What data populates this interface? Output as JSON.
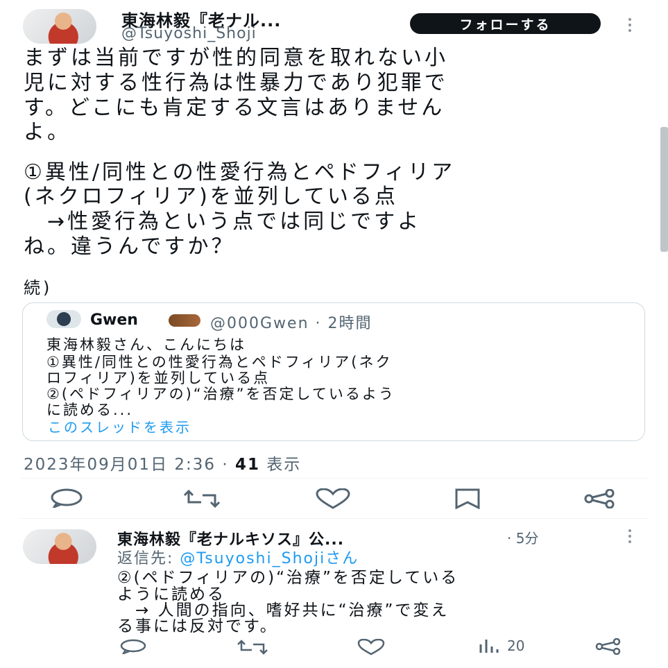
{
  "main_tweet": {
    "author_name": "東海林毅『老ナル...",
    "author_handle": "@Tsuyoshi_Shoji",
    "follow_label": "フォローする",
    "body_lines": [
      "まずは当前ですが性的同意を取れない小",
      "児に対する性行為は性暴力であり犯罪で",
      "す。どこにも肯定する文言はありません",
      "よ。",
      "①異性/同性との性愛行為とペドフィリア",
      "(ネクロフィリア)を並列している点",
      "　→性愛行為という点では同じですよ",
      "ね。違うんですか？",
      "続)"
    ],
    "quote": {
      "author_name": "Gwen",
      "meta": "@000Gwen · 2時間",
      "lines": [
        "東海林毅さん、こんにちは",
        "①異性/同性との性愛行為とペドフィリア(ネク",
        "ロフィリア)を並列している点",
        "②(ペドフィリアの)“治療”を否定しているよう",
        "に読める..."
      ],
      "show_thread": "このスレッドを表示"
    },
    "timestamp": "2023年09月01日 2:36",
    "views_count": "41",
    "views_label": "表示"
  },
  "reply_tweet": {
    "author_name": "東海林毅『老ナルキソス』公...",
    "time": "· 5分",
    "reply_prefix": "返信先: ",
    "reply_to": "@Tsuyoshi_Shojiさん",
    "body_lines": [
      "②(ペドフィリアの)“治療”を否定している",
      "ように読める",
      "　→ 人間の指向、嗜好共に“治療”で変え",
      "る事には反対です。"
    ],
    "view_count": "20"
  },
  "icons": {
    "reply": "comment-icon",
    "retweet": "retweet-icon",
    "like": "heart-icon",
    "bookmark": "bookmark-icon",
    "share": "share-icon",
    "views": "bar-chart-icon",
    "more": "more-vertical-icon"
  },
  "colors": {
    "text": "#0f1419",
    "secondary": "#536471",
    "link": "#1d9bf0",
    "border": "#cfd9de",
    "follow_bg": "#0f1419"
  }
}
